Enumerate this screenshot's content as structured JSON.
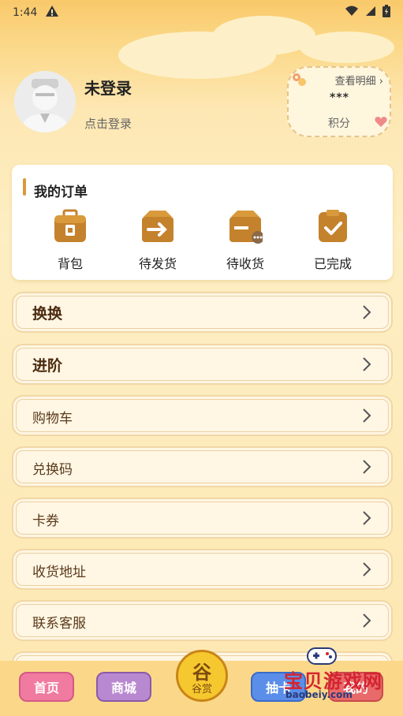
{
  "status_bar": {
    "time": "1:44",
    "alert_icon": "warning-icon",
    "signal_icons": [
      "wifi-icon",
      "signal-icon",
      "battery-icon"
    ]
  },
  "profile": {
    "name": "未登录",
    "login_link": "点击登录"
  },
  "points": {
    "detail_link": "查看明细",
    "value": "***",
    "label": "积分"
  },
  "orders": {
    "title": "我的订单",
    "items": [
      {
        "label": "背包",
        "icon": "backpack-icon"
      },
      {
        "label": "待发货",
        "icon": "to-ship-icon"
      },
      {
        "label": "待收货",
        "icon": "to-receive-icon"
      },
      {
        "label": "已完成",
        "icon": "completed-icon"
      }
    ]
  },
  "menu": [
    {
      "label": "换换",
      "bold": true
    },
    {
      "label": "进阶",
      "bold": true
    },
    {
      "label": "购物车",
      "bold": false
    },
    {
      "label": "兑换码",
      "bold": false
    },
    {
      "label": "卡券",
      "bold": false
    },
    {
      "label": "收货地址",
      "bold": false
    },
    {
      "label": "联系客服",
      "bold": false
    }
  ],
  "bottom_nav": {
    "home": "首页",
    "mall": "商城",
    "center_glyph": "谷",
    "center_label": "谷赏",
    "draw": "抽卡",
    "mine": "我的"
  },
  "watermark": {
    "title": "宝贝游戏网",
    "url": "baobeiy.com"
  },
  "colors": {
    "accent": "#d99a3c",
    "icon_brown": "#c4822c",
    "home_btn": "#f07aa0",
    "mall_btn": "#b888d0",
    "draw_btn": "#5a8ee8",
    "mine_btn": "#e86a6a"
  }
}
